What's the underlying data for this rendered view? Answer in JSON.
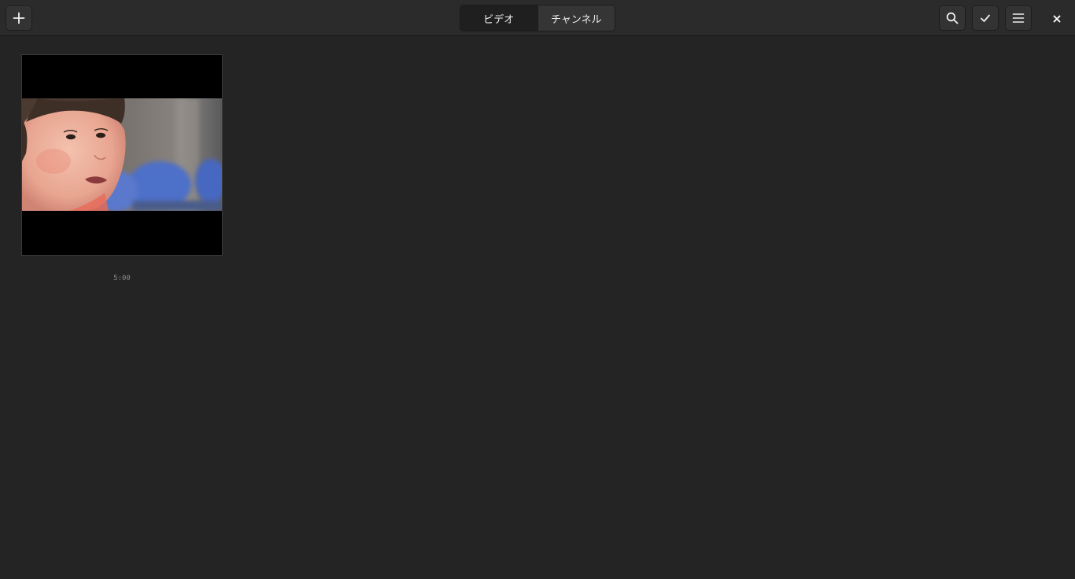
{
  "header": {
    "add_icon": "plus-icon",
    "tabs": [
      {
        "label": "ビデオ",
        "active": true
      },
      {
        "label": "チャンネル",
        "active": false
      }
    ],
    "search_icon": "search-icon",
    "select_icon": "checkmark-icon",
    "menu_icon": "hamburger-menu-icon",
    "close_icon": "close-icon"
  },
  "videos": [
    {
      "duration": "5:00"
    }
  ],
  "colors": {
    "background": "#242424",
    "headerbar": "#2b2b2b",
    "button": "#333333",
    "active_tab": "#1f1f1f"
  }
}
